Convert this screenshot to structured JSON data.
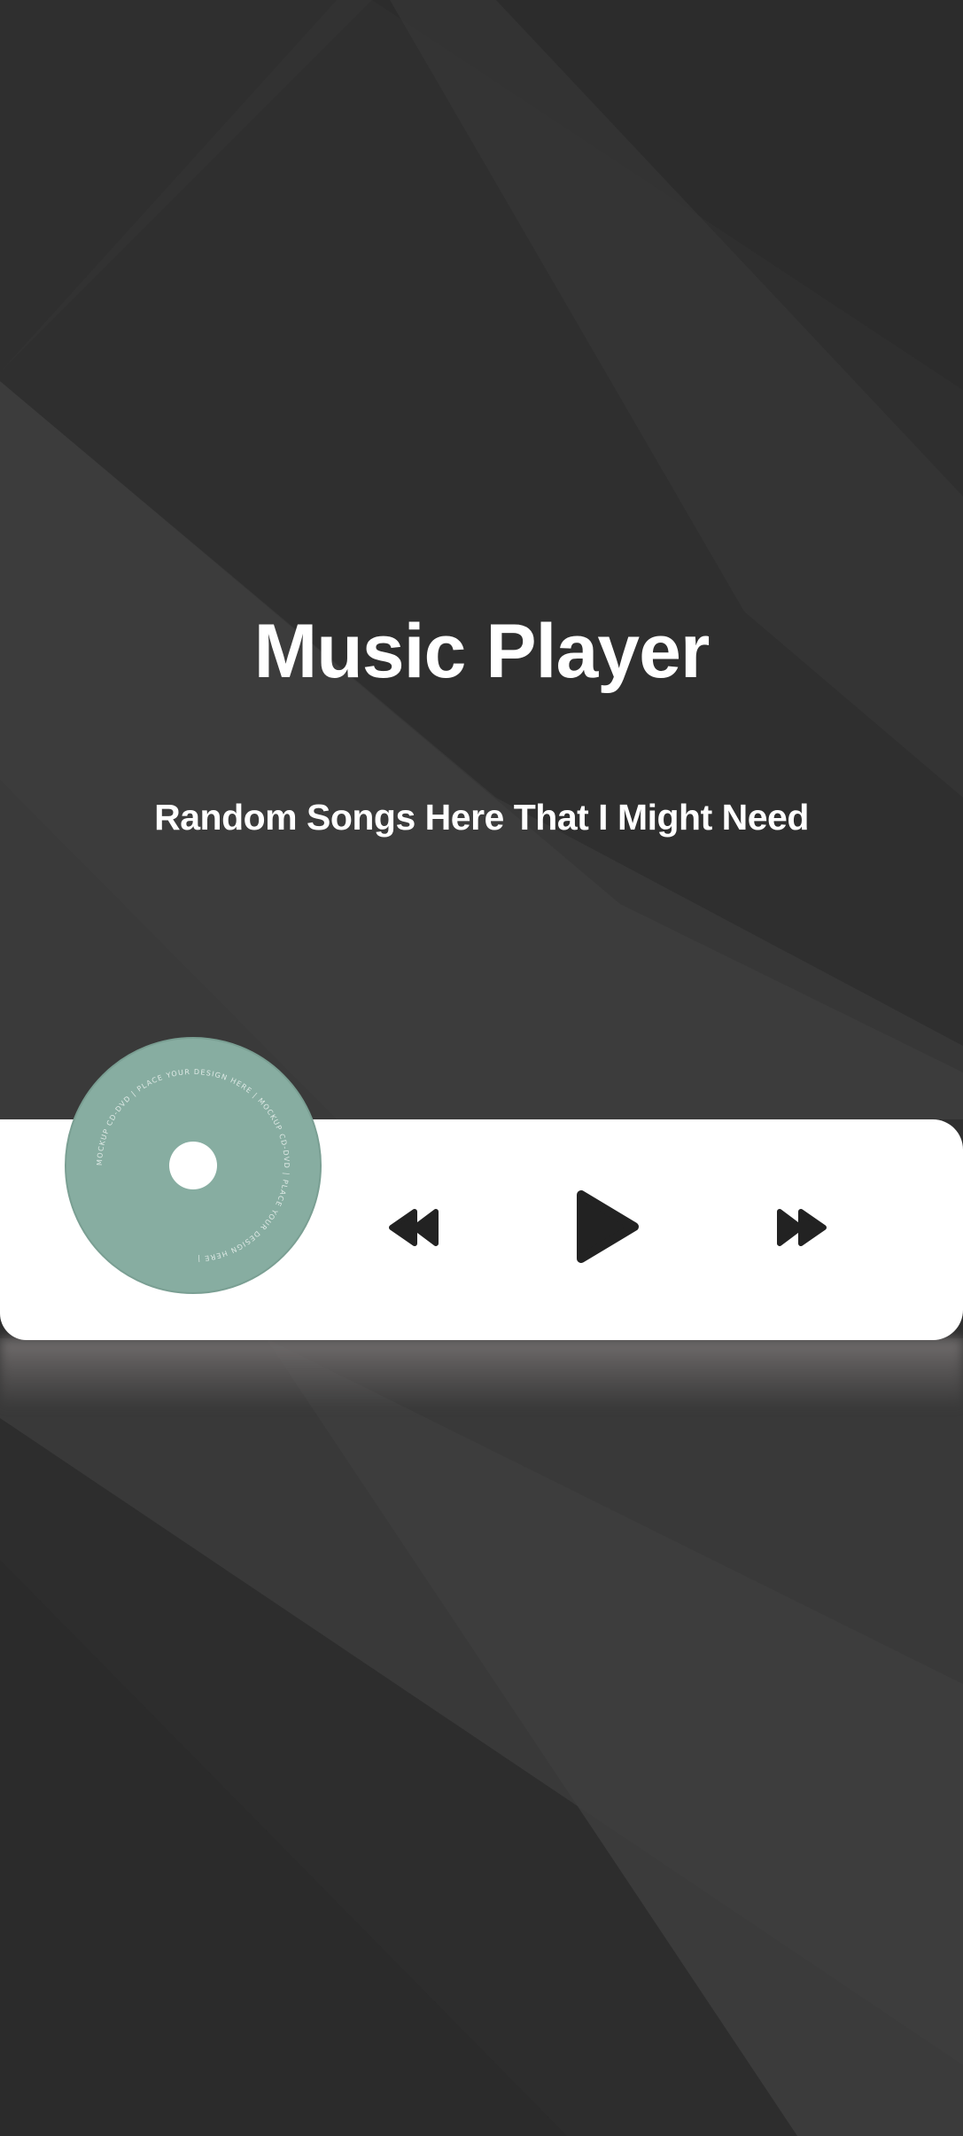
{
  "page": {
    "title": "Music Player",
    "subtitle": "Random Songs Here That I Might Need"
  },
  "player": {
    "disc": {
      "icon": "cd-disc-icon",
      "ring_text": "MOCKUP CD-DVD | PLACE YOUR DESIGN HERE | MOCKUP CD-DVD | PLACE YOUR DESIGN HERE |",
      "color": "#87ada1"
    },
    "controls": {
      "previous_icon": "rewind-icon",
      "play_icon": "play-icon",
      "next_icon": "fast-forward-icon"
    }
  },
  "colors": {
    "background": "#303030",
    "card": "#ffffff",
    "controls": "#222222",
    "text": "#ffffff"
  }
}
